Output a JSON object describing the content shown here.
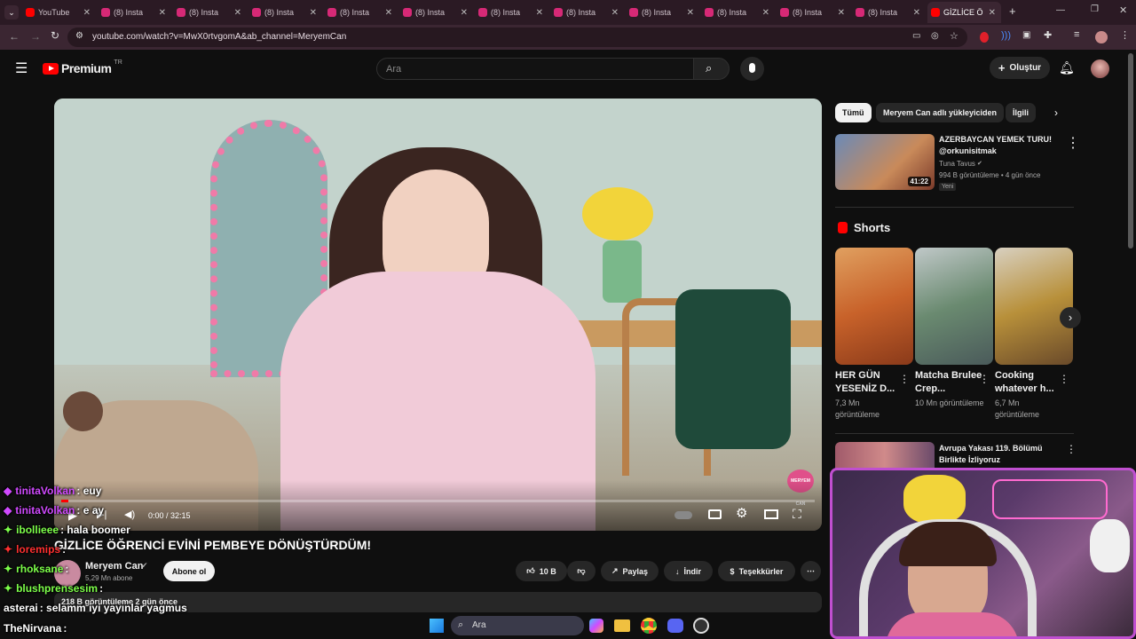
{
  "browser": {
    "tabs": [
      {
        "label": "YouTube",
        "color": "#ff0000"
      },
      {
        "label": "(8) Insta",
        "color": "#d62976"
      },
      {
        "label": "(8) Insta",
        "color": "#d62976"
      },
      {
        "label": "(8) Insta",
        "color": "#d62976"
      },
      {
        "label": "(8) Insta",
        "color": "#d62976"
      },
      {
        "label": "(8) Insta",
        "color": "#d62976"
      },
      {
        "label": "(8) Insta",
        "color": "#d62976"
      },
      {
        "label": "(8) Insta",
        "color": "#d62976"
      },
      {
        "label": "(8) Insta",
        "color": "#d62976"
      },
      {
        "label": "(8) Insta",
        "color": "#d62976"
      },
      {
        "label": "(8) Insta",
        "color": "#d62976"
      },
      {
        "label": "(8) Insta",
        "color": "#d62976"
      },
      {
        "label": "GİZLİCE Ö",
        "color": "#ff0000"
      }
    ],
    "url": "youtube.com/watch?v=MwX0rtvgomA&ab_channel=MeryemCan"
  },
  "header": {
    "logo_text": "Premium",
    "region": "TR",
    "search_placeholder": "Ara",
    "create_label": "Oluştur"
  },
  "player": {
    "time": "0:00 / 32:15",
    "watermark": "MERYEM CAN",
    "progress": 0.01
  },
  "video": {
    "title": "GİZLİCE ÖĞRENCİ EVİNİ PEMBEYE DÖNÜŞTÜRDÜM!",
    "channel": "Meryem Can",
    "subscribers": "5,29 Mn abone",
    "subscribe_label": "Abone ol",
    "stats": "218 B görüntüleme  2 gün önce",
    "likes": "10 B",
    "share_label": "Paylaş",
    "download_label": "İndir",
    "thanks_label": "Teşekkürler"
  },
  "sidebar": {
    "chips": [
      "Tümü",
      "Meryem Can adlı yükleyiciden",
      "İlgili"
    ],
    "rec1": {
      "title": "AZERBAYCAN YEMEK TURU! @orkunisitmak",
      "channel": "Tuna Tavus",
      "meta": "994 B görüntüleme • 4 gün önce",
      "badge": "Yeni",
      "duration": "41:22"
    },
    "shorts_title": "Shorts",
    "shorts": [
      {
        "title": "HER GÜN YESENİZ D...",
        "views": "7,3 Mn görüntüleme",
        "color": "#c8622a"
      },
      {
        "title": "Matcha Brulee Crep...",
        "views": "10 Mn görüntüleme",
        "color": "#6a8a70"
      },
      {
        "title": "Cooking whatever h...",
        "views": "6,7 Mn görüntüleme",
        "color": "#b8903a"
      }
    ],
    "rec2": {
      "title": "Avrupa Yakası 119. Bölümü Birlikte İzliyoruz"
    }
  },
  "chat": [
    {
      "user": "tinitaVolkan",
      "msg": ": euy",
      "color": "#d04aff"
    },
    {
      "user": "tinitaVolkan",
      "msg": ": e ay",
      "color": "#d04aff"
    },
    {
      "user": "ibollieee",
      "msg": ": hala boomer",
      "color": "#7dff4a"
    },
    {
      "user": "loremips",
      "msg": ":",
      "color": "#ff3030"
    },
    {
      "user": "rhoksane",
      "msg": ":",
      "color": "#7dff4a"
    },
    {
      "user": "blushprensesim",
      "msg": ":",
      "color": "#7dff4a"
    },
    {
      "user": "asterai",
      "msg": ": selamm iyi yayınlar yagmus",
      "color": "#ffffff"
    },
    {
      "user": "TheNirvana",
      "msg": ":",
      "color": "#ffffff"
    }
  ],
  "taskbar": {
    "search_placeholder": "Ara"
  }
}
